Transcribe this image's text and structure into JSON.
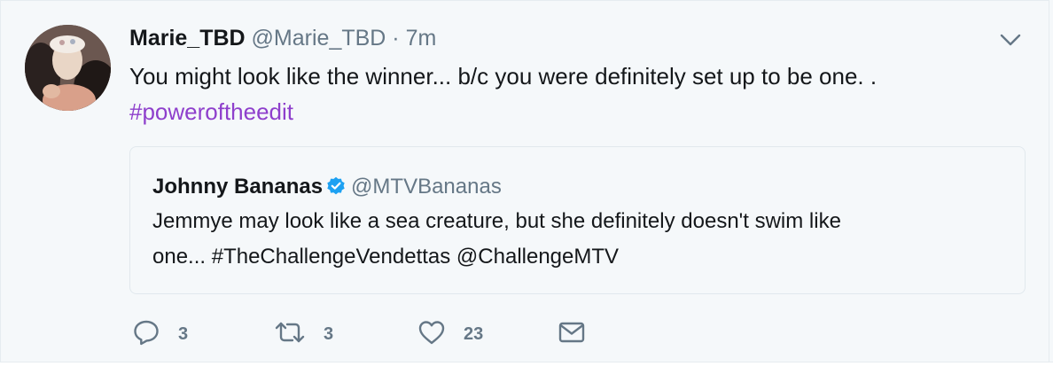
{
  "tweet": {
    "author": {
      "name": "Marie_TBD",
      "handle": "@Marie_TBD",
      "separator": "·",
      "time": "7m",
      "avatar": "avatar"
    },
    "text": "You might look like the winner... b/c you were definitely set up to be one. .",
    "hashtag": "#poweroftheedit",
    "caret_icon": "chevron-down-icon"
  },
  "quote": {
    "name": "Johnny Bananas",
    "verified_icon": "verified-badge-icon",
    "handle": "@MTVBananas",
    "text_line1": "Jemmye may look like a sea creature, but she definitely doesn't swim like",
    "text_line2": "one...  #TheChallengeVendettas @ChallengeMTV"
  },
  "actions": {
    "reply": {
      "icon": "reply-icon",
      "count": "3"
    },
    "retweet": {
      "icon": "retweet-icon",
      "count": "3"
    },
    "like": {
      "icon": "heart-icon",
      "count": "23"
    },
    "dm": {
      "icon": "envelope-icon"
    }
  },
  "colors": {
    "background": "#f5f8fa",
    "text": "#14171a",
    "secondary": "#657786",
    "hashtag": "#8e3fcc",
    "verified": "#1da1f2",
    "border": "#e1e8ed"
  }
}
